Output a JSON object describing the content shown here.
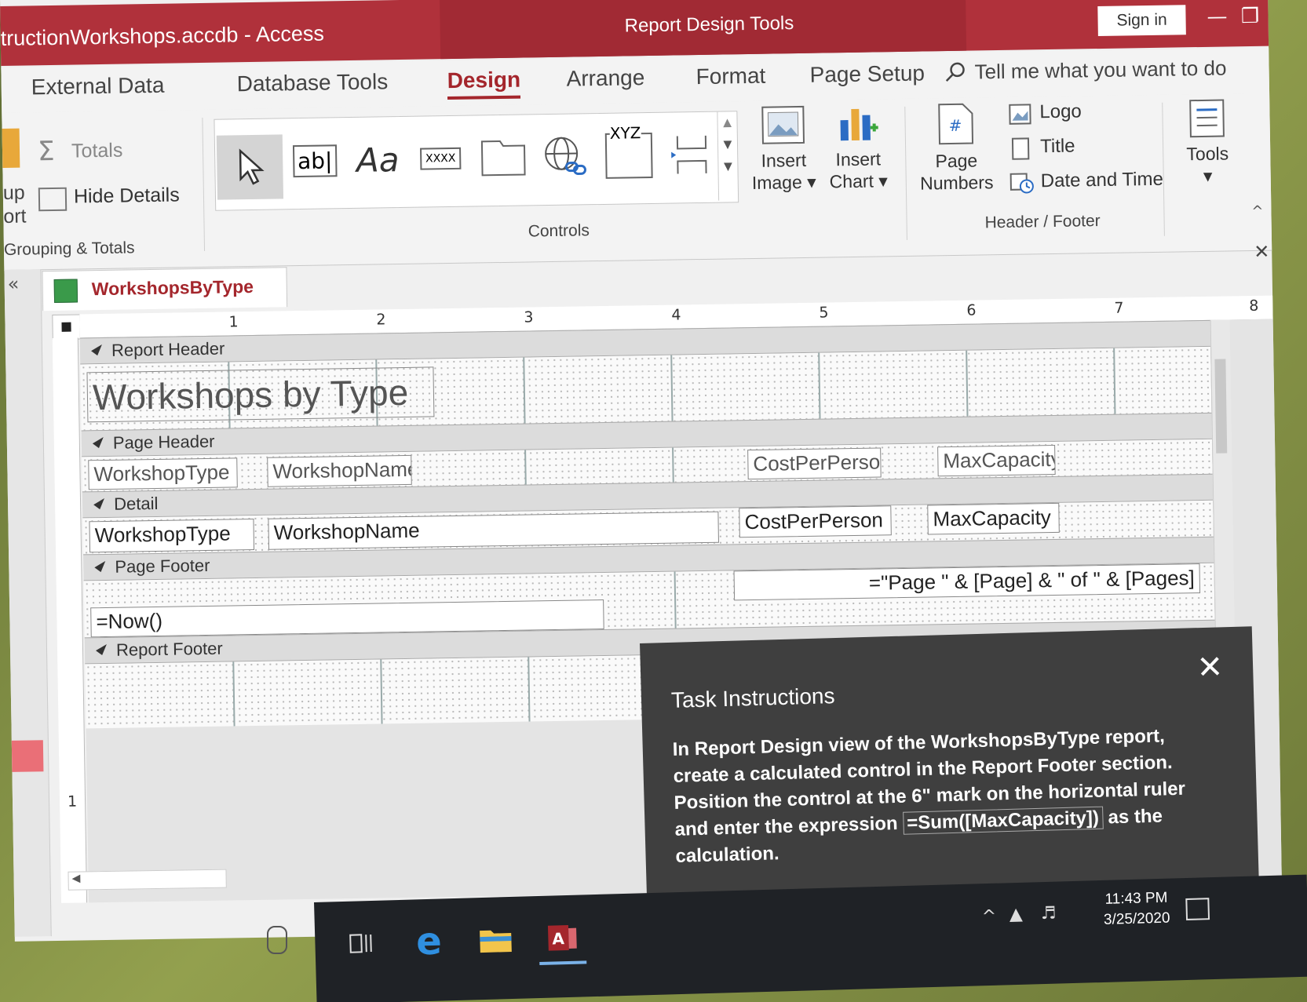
{
  "window": {
    "title": "tructionWorkshops.accdb - Access",
    "context_title": "Report Design Tools",
    "sign_in": "Sign in"
  },
  "tabs": [
    "External Data",
    "Database Tools",
    "Design",
    "Arrange",
    "Format",
    "Page Setup"
  ],
  "active_tab": "Design",
  "tell_me": "Tell me what you want to do",
  "ribbon": {
    "grouping": {
      "partial_top": "up",
      "partial_bottom": "ort",
      "totals": "Totals",
      "hide_details": "Hide Details",
      "label": "Grouping & Totals"
    },
    "controls": {
      "label": "Controls",
      "textbox_glyph": "ab|",
      "label_glyph": "Aa",
      "button_glyph": "XXXX",
      "xyz_glyph": "XYZ"
    },
    "insert_image": [
      "Insert",
      "Image"
    ],
    "insert_chart": [
      "Insert",
      "Chart"
    ],
    "header_footer": {
      "page_numbers": [
        "Page",
        "Numbers"
      ],
      "logo": "Logo",
      "title": "Title",
      "date_time": "Date and Time",
      "label": "Header / Footer"
    },
    "tools": "Tools"
  },
  "document_tab": "WorkshopsByType",
  "ruler_numbers": [
    "1",
    "2",
    "3",
    "4",
    "5",
    "6",
    "7",
    "8"
  ],
  "vruler_number": "1",
  "sections": {
    "report_header": "Report Header",
    "page_header": "Page Header",
    "detail": "Detail",
    "page_footer": "Page Footer",
    "report_footer": "Report Footer"
  },
  "controls_on_report": {
    "title": "Workshops by Type",
    "ph_workshop_type": "WorkshopType",
    "ph_workshop_name": "WorkshopName",
    "ph_cost": "CostPerPerson",
    "ph_max": "MaxCapacity",
    "d_workshop_type": "WorkshopType",
    "d_workshop_name": "WorkshopName",
    "d_cost": "CostPerPerson",
    "d_max": "MaxCapacity",
    "pf_now": "=Now()",
    "pf_page": "=\"Page \" & [Page] & \" of \" & [Pages]"
  },
  "task": {
    "heading": "Task Instructions",
    "body_before": "In Report Design view of the WorkshopsByType report, create a calculated control in the Report Footer section. Position the control at the 6\" mark on the horizontal ruler and enter the expression ",
    "expression": "=Sum([MaxCapacity])",
    "body_after": " as the calculation."
  },
  "clock": {
    "time": "11:43 PM",
    "date": "3/25/2020"
  },
  "colors": {
    "access_red": "#a4262c",
    "titlebar": "#b0313b"
  }
}
